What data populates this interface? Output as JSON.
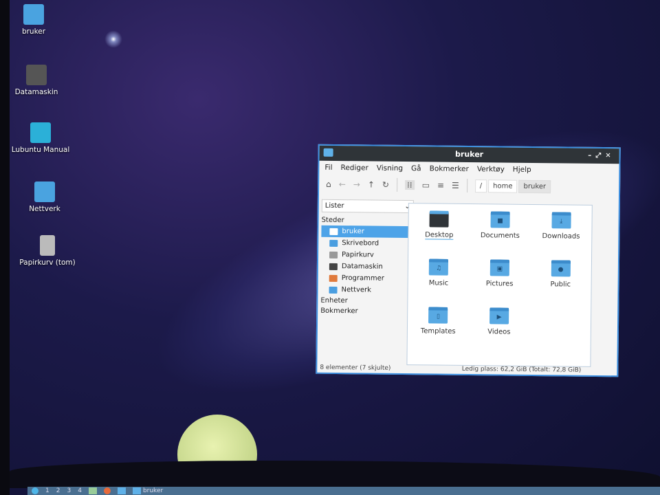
{
  "desktop": {
    "icons": [
      {
        "label": "bruker",
        "icon": "home-folder-icon",
        "color": "#4aa3e0"
      },
      {
        "label": "Datamaskin",
        "icon": "computer-icon",
        "color": "#555555"
      },
      {
        "label": "Lubuntu Manual",
        "icon": "manual-icon",
        "color": "#2bb0d8"
      },
      {
        "label": "Nettverk",
        "icon": "network-folder-icon",
        "color": "#4aa3e0"
      },
      {
        "label": "Papirkurv (tom)",
        "icon": "trash-icon",
        "color": "#bbbbbb"
      }
    ]
  },
  "window": {
    "title": "bruker",
    "menu": [
      "Fil",
      "Rediger",
      "Visning",
      "Gå",
      "Bokmerker",
      "Verktøy",
      "Hjelp"
    ],
    "breadcrumb": [
      "/",
      "home",
      "bruker"
    ],
    "sidebar": {
      "mode": "Lister",
      "sections": {
        "places": "Steder",
        "devices": "Enheter",
        "bookmarks": "Bokmerker"
      },
      "items": [
        {
          "label": "bruker",
          "color": "#4da3e8"
        },
        {
          "label": "Skrivebord",
          "color": "#4a9ee0"
        },
        {
          "label": "Papirkurv",
          "color": "#999999"
        },
        {
          "label": "Datamaskin",
          "color": "#444444"
        },
        {
          "label": "Programmer",
          "color": "#e07a3c"
        },
        {
          "label": "Nettverk",
          "color": "#4a9ee0"
        }
      ]
    },
    "files": [
      {
        "name": "Desktop",
        "glyph": "▬"
      },
      {
        "name": "Documents",
        "glyph": "■"
      },
      {
        "name": "Downloads",
        "glyph": "⤓"
      },
      {
        "name": "Music",
        "glyph": "♫"
      },
      {
        "name": "Pictures",
        "glyph": "▣"
      },
      {
        "name": "Public",
        "glyph": "●"
      },
      {
        "name": "Templates",
        "glyph": "▯"
      },
      {
        "name": "Videos",
        "glyph": "▶"
      }
    ],
    "status": {
      "left": "8 elementer (7 skjulte)",
      "right": "Ledig plass: 62,2 GiB (Totalt: 72,8 GiB)"
    }
  },
  "taskbar": {
    "workspaces": [
      "1",
      "2",
      "3",
      "4"
    ],
    "task": "bruker"
  }
}
